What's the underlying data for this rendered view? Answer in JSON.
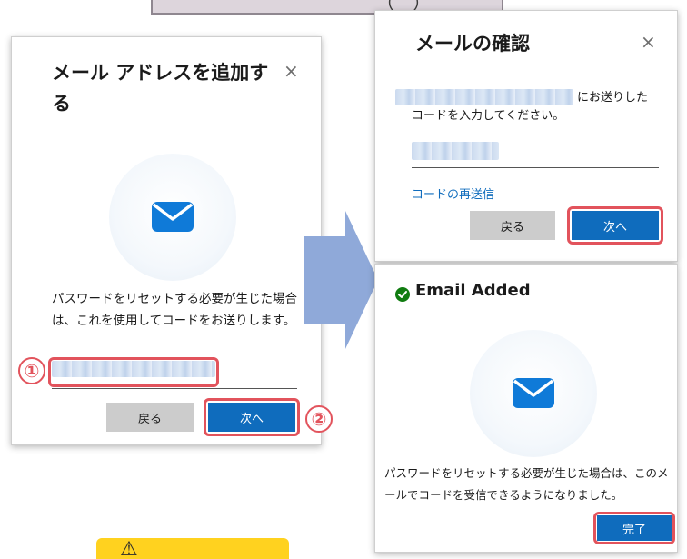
{
  "top_banner": {
    "text": "（　）"
  },
  "dialog_add": {
    "title": "メール アドレスを追加する",
    "close_label": "×",
    "description": "パスワードをリセットする必要が生じた場合は、これを使用してコードをお送りします。",
    "back_label": "戻る",
    "next_label": "次へ",
    "step1_marker": "①",
    "step2_marker": "②"
  },
  "dialog_verify": {
    "title": "メールの確認",
    "close_label": "×",
    "sent_text": "にお送りした",
    "instruction": "コードを入力してください。",
    "resend_label": "コードの再送信",
    "back_label": "戻る",
    "next_label": "次へ"
  },
  "dialog_added": {
    "title": "Email Added",
    "description": "パスワードをリセットする必要が生じた場合は、このメールでコードを受信できるようになりました。",
    "done_label": "完了"
  },
  "warning": {
    "icon": "warning-icon",
    "icon_glyph": "⚠"
  },
  "colors": {
    "accent": "#0f6cbd",
    "highlight": "#e2535c",
    "envelope": "#0f7ad8",
    "success": "#107c10",
    "flow_arrow": "#8fa9d9",
    "warning_bg": "#ffd21f"
  }
}
